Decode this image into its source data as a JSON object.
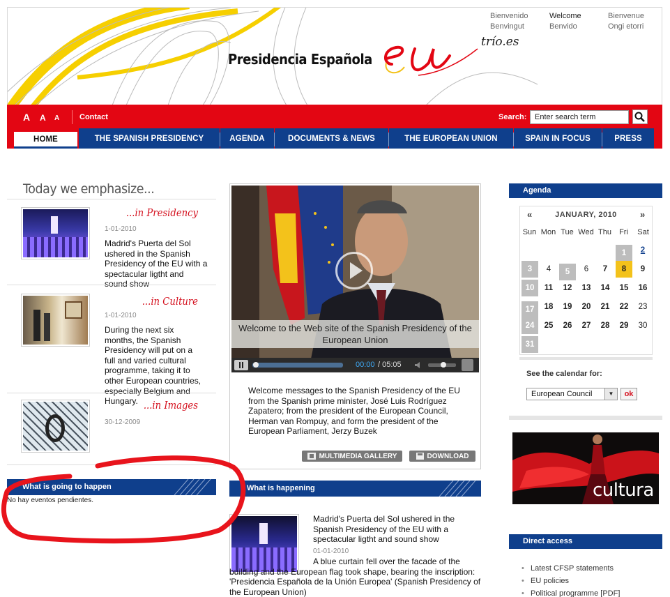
{
  "header": {
    "title": "Presidencia Española",
    "logo_text": "eu",
    "trio": "trío.es",
    "languages": [
      "Bienvenido",
      "Welcome",
      "Bienvenue",
      "Benvingut",
      "Benvido",
      "Ongi etorri"
    ],
    "active_language": "Welcome"
  },
  "toolbar": {
    "font_sizes": [
      "A",
      "A",
      "A"
    ],
    "contact": "Contact",
    "search_label": "Search:",
    "search_placeholder": "Enter search term"
  },
  "nav": {
    "tabs": [
      "HOME",
      "THE SPANISH PRESIDENCY",
      "AGENDA",
      "DOCUMENTS & NEWS",
      "THE EUROPEAN UNION",
      "SPAIN IN FOCUS",
      "PRESS"
    ],
    "active": "HOME"
  },
  "emphasize": {
    "title": "Today we emphasize...",
    "items": [
      {
        "section": "...in Presidency",
        "date": "1-01-2010",
        "text": "Madrid's Puerta del Sol ushered in the Spanish Presidency of the EU with a spectacular ligtht and sound show"
      },
      {
        "section": "...in Culture",
        "date": "1-01-2010",
        "text": "During the next six months, the Spanish Presidency will put on a full and varied cultural programme, taking it to other European countries, especially Belgium and Hungary."
      },
      {
        "section": "...in Images",
        "date": "30-12-2009",
        "text": ""
      }
    ]
  },
  "going_to_happen": {
    "title": "What is going to happen",
    "empty_text": "No hay eventos pendientes."
  },
  "video": {
    "caption": "Welcome to the Web site of the Spanish Presidency of the European Union",
    "time_current": "00:00",
    "time_total": "/ 05:05",
    "description": "Welcome messages to the Spanish Presidency of the EU from the Spanish prime minister, José Luis Rodríguez Zapatero; from the president of the European Council, Herman van Rompuy, and form the president of the European Parliament, Jerzy Buzek",
    "gallery_label": "MULTIMEDIA GALLERY",
    "download_label": "DOWNLOAD"
  },
  "happening": {
    "title": "What is happening",
    "headline": "Madrid's Puerta del Sol ushered in the Spanish Presidency of the EU with a spectacular ligtht and sound show",
    "date": "01-01-2010",
    "text": "A blue curtain fell over the facade of the building and the European flag took shape, bearing the inscription: 'Presidencia Española de la Unión Europea' (Spanish Presidency of the European Union)"
  },
  "agenda": {
    "title": "Agenda",
    "month": "JANUARY, 2010",
    "prev": "«",
    "next": "»",
    "weekdays": [
      "Sun",
      "Mon",
      "Tue",
      "Wed",
      "Thu",
      "Fri",
      "Sat"
    ],
    "see_calendar": "See the calendar for:",
    "selected_calendar": "European Council",
    "ok_label": "ok"
  },
  "cultura": {
    "text": "cultura"
  },
  "direct_access": {
    "title": "Direct access",
    "links": [
      "Latest CFSP statements",
      "EU policies",
      "Political programme [PDF]"
    ]
  },
  "colors": {
    "red": "#e30613",
    "blue": "#0f3f8c",
    "yellow": "#f3c21b",
    "annotation": "#e8141c"
  }
}
